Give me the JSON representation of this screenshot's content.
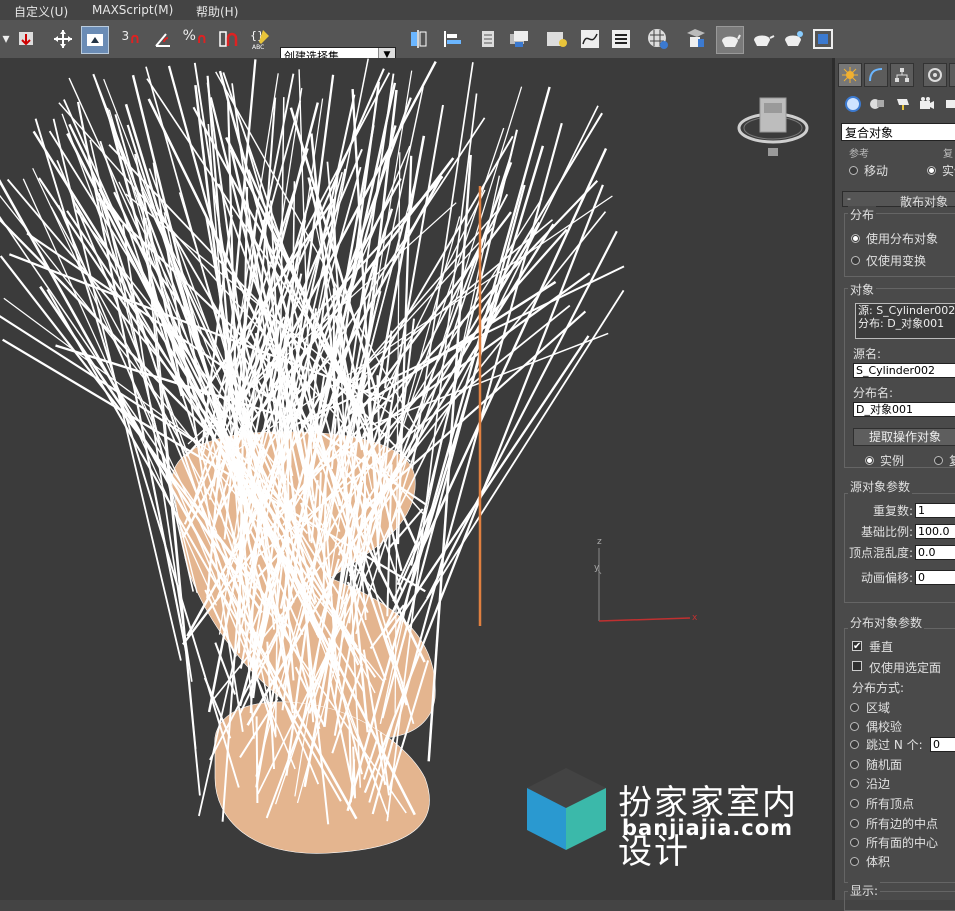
{
  "menu": {
    "items": [
      "自定义(U)",
      "MAXScript(M)",
      "帮助(H)"
    ]
  },
  "toolbar": {
    "selection_set_value": "创建选择集",
    "angle_snap_label": "3",
    "percent_snap_label": "%"
  },
  "viewport": {
    "axis": {
      "z": "z",
      "y": "y",
      "x": "x"
    }
  },
  "watermark": {
    "title": "扮家家室内设计",
    "subtitle": "banjiajia.com"
  },
  "panel": {
    "category": "复合对象",
    "partial_top": "实例",
    "move_label": "移动",
    "instance_label_top": "实例",
    "rollout_scatter": "散布对象",
    "distribution": {
      "title": "分布",
      "use_dist_object": "使用分布对象",
      "use_transforms_only": "仅使用变换"
    },
    "objects": {
      "title": "对象",
      "list": [
        "源: S_Cylinder002",
        "分布: D_对象001"
      ],
      "source_name_label": "源名:",
      "source_name": "S_Cylinder002",
      "dist_name_label": "分布名:",
      "dist_name": "D_对象001",
      "extract_button": "提取操作对象",
      "instance": "实例",
      "copy": "复制"
    },
    "source_params": {
      "title": "源对象参数",
      "duplicates_label": "重复数:",
      "duplicates": "1",
      "base_scale_label": "基础比例:",
      "base_scale": "100.0",
      "vertex_chaos_label": "顶点混乱度:",
      "vertex_chaos": "0.0",
      "anim_offset_label": "动画偏移:",
      "anim_offset": "0"
    },
    "dist_params": {
      "title": "分布对象参数",
      "perpendicular": "垂直",
      "perpendicular_checked": true,
      "use_selected_faces": "仅使用选定面",
      "use_selected_faces_checked": false,
      "method_label": "分布方式:",
      "area": "区域",
      "even": "偶校验",
      "skip_n": "跳过 N 个:",
      "skip_n_value": "0",
      "random_faces": "随机面",
      "along_edges": "沿边",
      "all_vertices": "所有顶点",
      "all_edge_midpoints": "所有边的中点",
      "all_face_centers": "所有面的中心",
      "volume": "体积"
    },
    "display_label": "显示:"
  },
  "colors": {
    "viewport_bg": "#3b3b3b",
    "wire": "#ffffff",
    "mesh_fill": "#e4b58f",
    "orange_line": "#e08040",
    "panel_bg": "#4a4a4a"
  }
}
